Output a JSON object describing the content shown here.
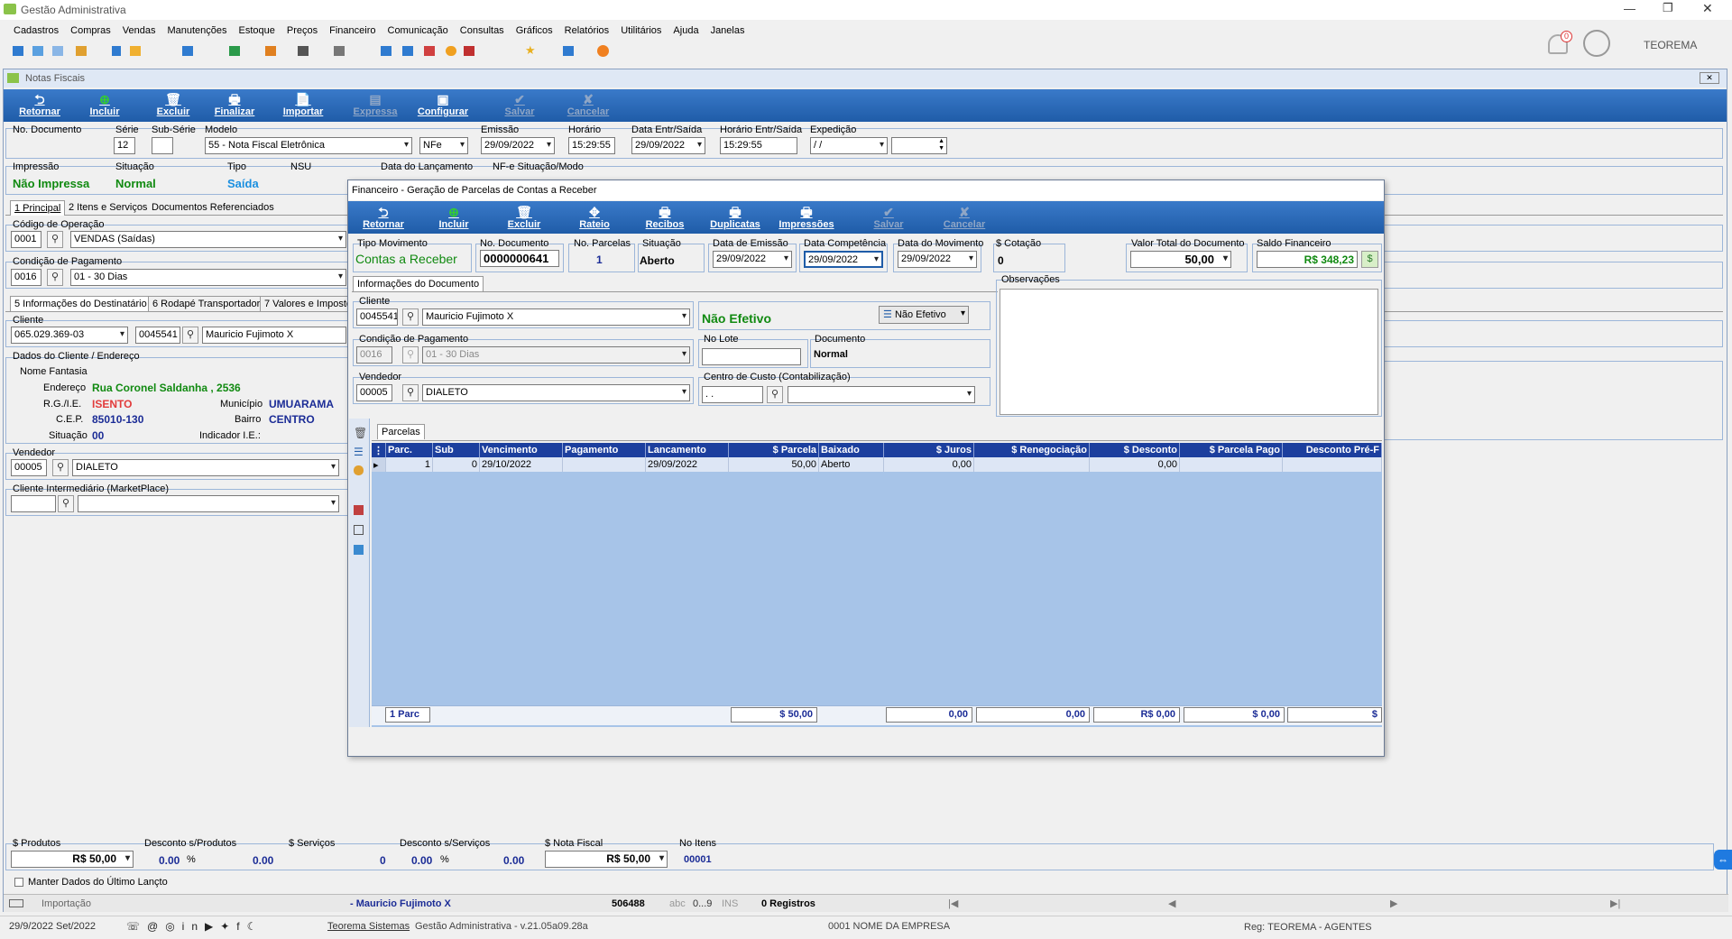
{
  "app": {
    "title": "Gestão Administrativa",
    "user": "TEOREMA",
    "notifications": "0"
  },
  "menu": [
    "Cadastros",
    "Compras",
    "Vendas",
    "Manutenções",
    "Estoque",
    "Preços",
    "Financeiro",
    "Comunicação",
    "Consultas",
    "Gráficos",
    "Relatórios",
    "Utilitários",
    "Ajuda",
    "Janelas"
  ],
  "nf": {
    "title": "Notas Fiscais",
    "toolbar": [
      "Retornar",
      "Incluir",
      "Excluir",
      "Finalizar",
      "Importar",
      "Expressa",
      "Configurar",
      "Salvar",
      "Cancelar"
    ],
    "labels": {
      "doc": "No. Documento",
      "serie": "Série",
      "subserie": "Sub-Série",
      "modelo": "Modelo",
      "emissao": "Emissão",
      "horario": "Horário",
      "data_es": "Data Entr/Saída",
      "hora_es": "Horário Entr/Saída",
      "expedicao": "Expedição",
      "impressao": "Impressão",
      "situacao": "Situação",
      "tipo": "Tipo",
      "nsu": "NSU",
      "data_lanc": "Data do Lançamento",
      "nfe_sit": "NF-e Situação/Modo",
      "cod_op": "Código de Operação",
      "cond_pag": "Condição de Pagamento",
      "cliente": "Cliente",
      "dados_cli": "Dados do Cliente / Endereço",
      "nome_fantasia": "Nome Fantasia",
      "endereco": "Endereço",
      "rg": "R.G./I.E.",
      "cep": "C.E.P.",
      "situacao2": "Situação",
      "municipio": "Município",
      "bairro": "Bairro",
      "ind_ie": "Indicador I.E.:",
      "vendedor": "Vendedor",
      "cli_inter": "Cliente Intermediário (MarketPlace)"
    },
    "serie": "12",
    "modelo": "55 - Nota Fiscal Eletrônica",
    "nfe": "NFe",
    "emissao": "29/09/2022",
    "horario": "15:29:55",
    "data_es": "29/09/2022",
    "hora_es": "15:29:55",
    "expedicao": " / /",
    "impressao": "Não Impressa",
    "situacao": "Normal",
    "tipo": "Saída",
    "tabs1": [
      "1 Principal",
      "2 Itens e Serviços",
      "Documentos Referenciados"
    ],
    "cod_op_code": "0001",
    "cod_op_desc": "VENDAS (Saídas)",
    "cond_code": "0016",
    "cond_desc": "01 - 30 Dias",
    "tabs2": [
      "5 Informações do Destinatário",
      "6 Rodapé Transportador",
      "7 Valores e Impostos"
    ],
    "cli_cpf": "065.029.369-03",
    "cli_code": "0045541",
    "cli_name": "Mauricio Fujimoto X",
    "endereco": "Rua Coronel Saldanha , 2536",
    "rg": "ISENTO",
    "cep": "85010-130",
    "situacao_cli": "00",
    "municipio": "UMUARAMA",
    "bairro": "CENTRO",
    "vend_code": "00005",
    "vend_name": "DIALETO"
  },
  "fin": {
    "title": "Financeiro - Geração de Parcelas de Contas a Receber",
    "toolbar": [
      "Retornar",
      "Incluir",
      "Excluir",
      "Rateio",
      "Recibos",
      "Duplicatas",
      "Impressões",
      "Salvar",
      "Cancelar"
    ],
    "labels": {
      "tipo_mov": "Tipo Movimento",
      "no_doc": "No. Documento",
      "no_parc": "No. Parcelas",
      "situacao": "Situação",
      "data_em": "Data de Emissão",
      "data_comp": "Data Competência",
      "data_mov": "Data do Movimento",
      "cotacao": "$ Cotação",
      "valor_total": "Valor Total do Documento",
      "saldo": "Saldo Financeiro",
      "info_tab": "Informações do Documento",
      "obs": "Observações",
      "cliente": "Cliente",
      "cond": "Condição de Pagamento",
      "no_lote": "No Lote",
      "documento": "Documento",
      "vendedor": "Vendedor",
      "centro": "Centro de Custo (Contabilização)",
      "parcelas_tab": "Parcelas"
    },
    "tipo_mov": "Contas a Receber",
    "no_doc": "0000000641",
    "no_parc": "1",
    "situacao": "Aberto",
    "data_em": "29/09/2022",
    "data_comp": "29/09/2022",
    "data_mov": "29/09/2022",
    "cotacao": "0",
    "valor_total": "50,00",
    "saldo": "R$ 348,23",
    "cli_code": "0045541",
    "cli_name": "Mauricio Fujimoto X",
    "efetivo": "Não Efetivo",
    "efetivo_btn": "Não Efetivo",
    "cond_code": "0016",
    "cond_desc": "01 - 30 Dias",
    "documento": "Normal",
    "vend_code": "00005",
    "vend_name": "DIALETO",
    "centro": " .  .",
    "grid_headers": [
      "Parc.",
      "Sub",
      "Vencimento",
      "Pagamento",
      "Lancamento",
      "$ Parcela",
      "Baixado",
      "$ Juros",
      "$ Renegociação",
      "$ Desconto",
      "$ Parcela Pago",
      "Desconto Pré-F"
    ],
    "grid_row": [
      "1",
      "0",
      "29/10/2022",
      "",
      "29/09/2022",
      "50,00",
      "Aberto",
      "0,00",
      "",
      "0,00",
      "",
      ""
    ],
    "totals": [
      "1 Parc",
      "$ 50,00",
      "0,00",
      "0,00",
      "R$ 0,00",
      "$ 0,00",
      "$"
    ]
  },
  "bottom": {
    "labels": [
      "$ Produtos",
      "Desconto s/Produtos",
      "$ Serviços",
      "Desconto s/Serviços",
      "$ Nota Fiscal",
      "No Itens"
    ],
    "produtos": "R$ 50,00",
    "desc_prod_pct": "0.00",
    "desc_prod": "0.00",
    "servicos": "0",
    "desc_serv_pct": "0.00",
    "desc_serv": "0.00",
    "nota": "R$ 50,00",
    "itens": "00001",
    "manter": "Manter Dados do Último Lançto",
    "importacao": "Importação",
    "cliente": "- Mauricio Fujimoto X",
    "num": "506488",
    "abc": "abc",
    "n09": "0...9",
    "ins": "INS",
    "registros": "0 Registros",
    "date": "29/9/2022 Set/2022",
    "company": "Teorema Sistemas",
    "version": "Gestão Administrativa - v.21.05a09.28a",
    "empresa": "0001 NOME DA EMPRESA",
    "reg": "Reg: TEOREMA - AGENTES"
  }
}
